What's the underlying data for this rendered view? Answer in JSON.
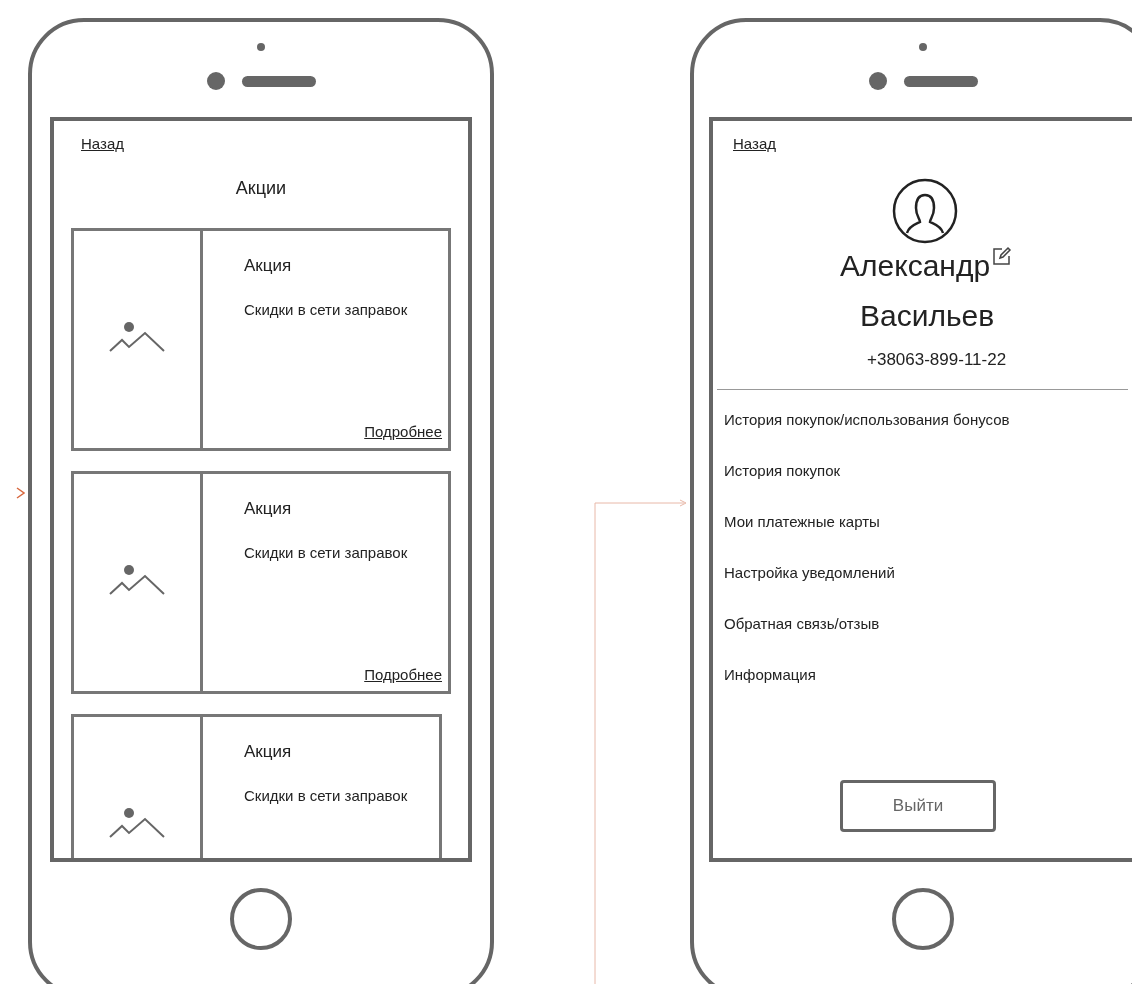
{
  "phones": [
    {
      "kind": "promo-list",
      "back_link": "Назад",
      "title": "Акции",
      "cards": [
        {
          "title": "Акция",
          "text": "Скидки в сети заправок",
          "more_link": "Подробнее"
        },
        {
          "title": "Акция",
          "text": "Скидки в сети заправок",
          "more_link": "Подробнее"
        },
        {
          "title": "Акция",
          "text": "Скидки в сети заправок"
        }
      ]
    },
    {
      "kind": "profile",
      "back_link": "Назад",
      "first_name": "Александр",
      "last_name": "Васильев",
      "phone": "+38063-899-11-22",
      "menu": [
        {
          "label": "История покупок/использования бонусов"
        },
        {
          "label": "История покупок"
        },
        {
          "label": "Мои платежные карты"
        },
        {
          "label": "Настройка уведомлений"
        },
        {
          "label": "Обратная связь/отзыв"
        },
        {
          "label": "Информация"
        }
      ],
      "logout_button": "Выйти"
    }
  ]
}
